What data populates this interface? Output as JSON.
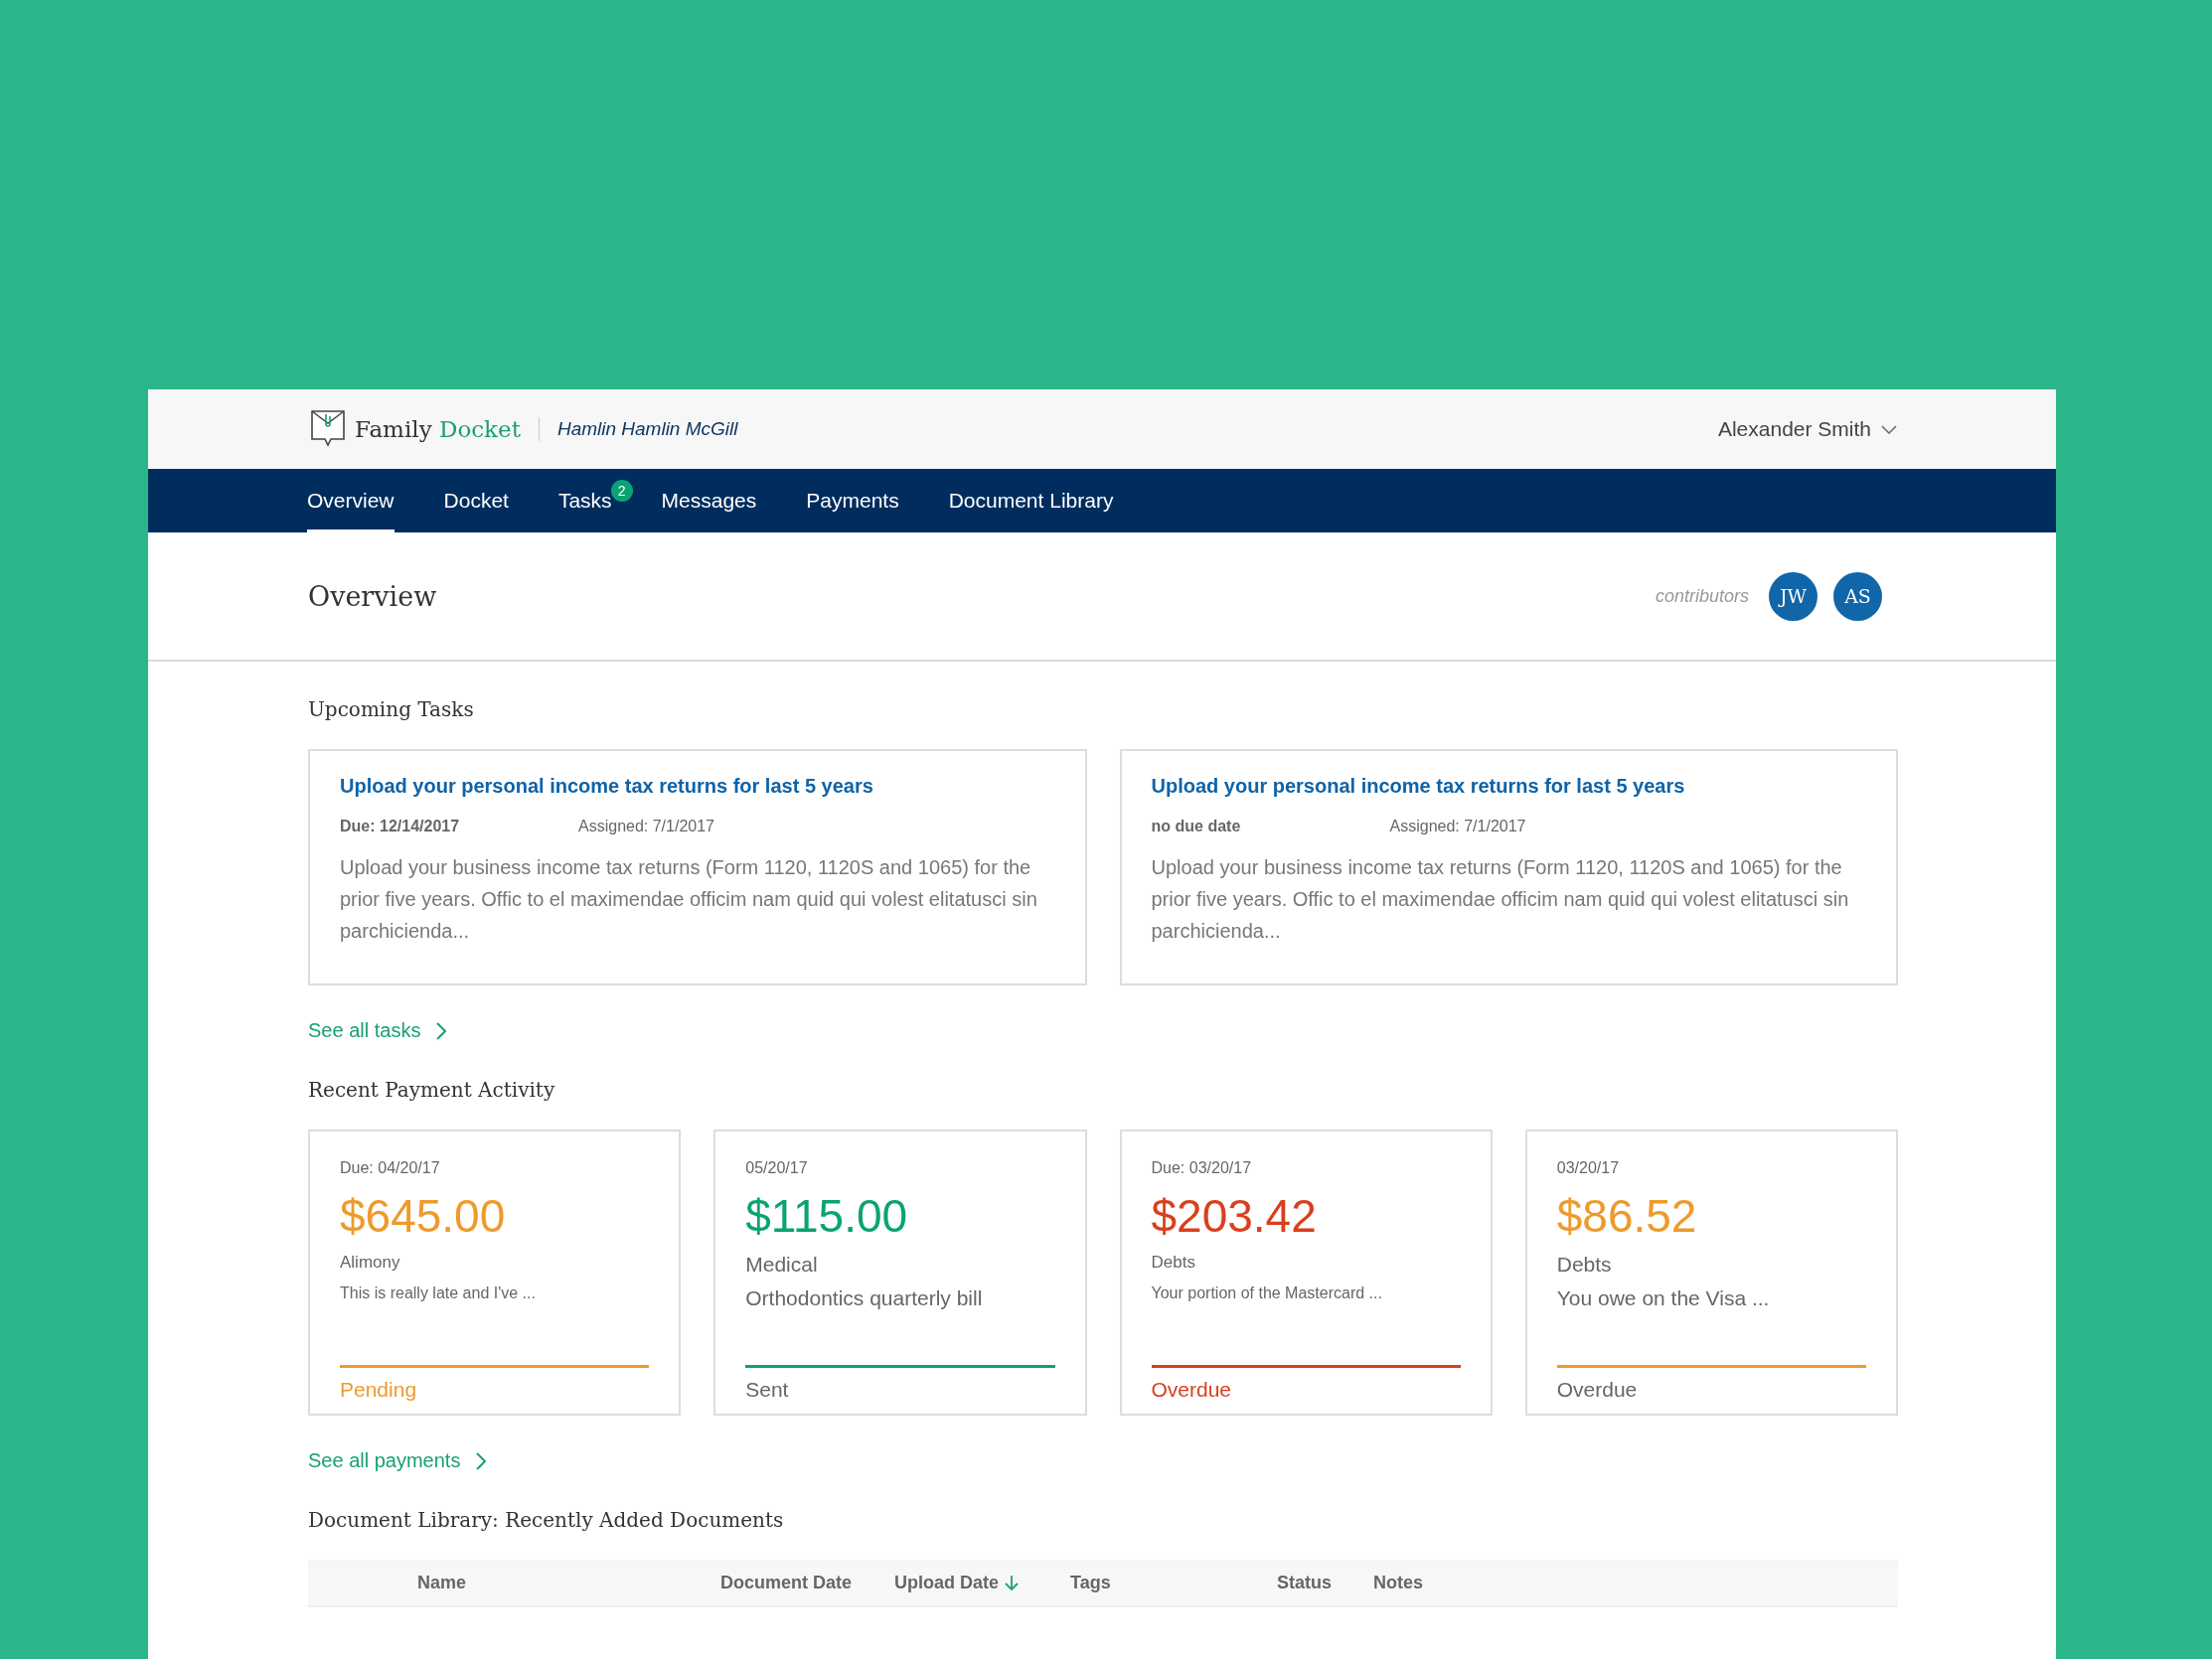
{
  "header": {
    "brand_first": "Family",
    "brand_second": "Docket",
    "case_name": "Hamlin Hamlin McGill",
    "user_name": "Alexander Smith"
  },
  "nav": [
    {
      "label": "Overview",
      "selected": true
    },
    {
      "label": "Docket",
      "selected": false
    },
    {
      "label": "Tasks",
      "selected": false,
      "badge": "2"
    },
    {
      "label": "Messages",
      "selected": false
    },
    {
      "label": "Payments",
      "selected": false
    },
    {
      "label": "Document Library",
      "selected": false
    }
  ],
  "page": {
    "title": "Overview",
    "contributors_label": "contributors",
    "contributors": [
      "JW",
      "AS"
    ]
  },
  "upcoming_tasks": {
    "heading": "Upcoming Tasks",
    "tasks": [
      {
        "title": "Upload your personal income tax returns for last 5 years",
        "due": "Due: 12/14/2017",
        "assigned": "Assigned: 7/1/2017",
        "description": "Upload your business income tax returns (Form 1120, 1120S and 1065) for the prior five years. Offic to el maximendae officim nam quid qui volest elitatusci sin parchicienda..."
      },
      {
        "title": "Upload your personal income tax returns for last 5 years",
        "due": "no due date",
        "assigned": "Assigned: 7/1/2017",
        "description": "Upload your business income tax returns (Form 1120, 1120S and 1065) for the prior five years. Offic to el maximendae officim nam quid qui volest elitatusci sin parchicienda..."
      }
    ],
    "link": "See all tasks"
  },
  "payments": {
    "heading": "Recent Payment Activity",
    "cards": [
      {
        "kind": "compact",
        "date": "Due: 04/20/17",
        "amount": "$645.00",
        "category": "Alimony",
        "note": "This is really late and I've ...",
        "status": "Pending",
        "color": "#ee9a2c",
        "status_highlighted": true
      },
      {
        "kind": "regular",
        "date": "05/20/17",
        "amount": "$115.00",
        "category": "Medical",
        "note": "Orthodontics quarterly bill",
        "status": "Sent",
        "color": "#0aa373",
        "status_highlighted": false
      },
      {
        "kind": "compact",
        "date": "Due: 03/20/17",
        "amount": "$203.42",
        "category": "Debts",
        "note": "Your portion of the Mastercard ...",
        "status": "Overdue",
        "color": "#d93f1e",
        "status_highlighted": true
      },
      {
        "kind": "regular",
        "date": "03/20/17",
        "amount": "$86.52",
        "category": "Debts",
        "note": "You owe on the Visa ...",
        "status": "Overdue",
        "color": "#ee9a2c",
        "status_highlighted": false
      }
    ],
    "link": "See all payments"
  },
  "documents": {
    "heading": "Document Library: Recently Added Documents",
    "columns": [
      {
        "label": "Name",
        "sorted": false
      },
      {
        "label": "Document Date",
        "sorted": false
      },
      {
        "label": "Upload Date",
        "sorted": true
      },
      {
        "label": "Tags",
        "sorted": false
      },
      {
        "label": "Status",
        "sorted": false
      },
      {
        "label": "Notes",
        "sorted": false
      }
    ]
  }
}
